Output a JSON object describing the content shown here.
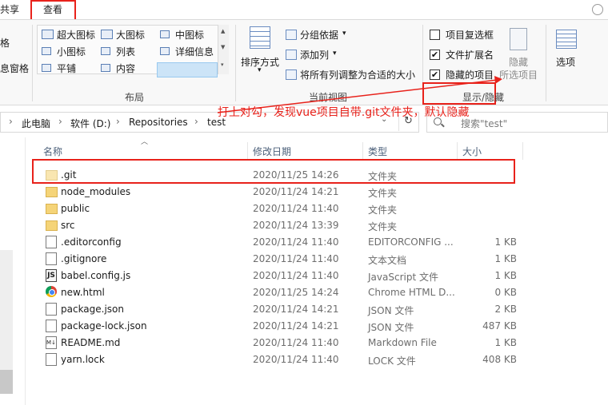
{
  "tabs": {
    "share": "共享",
    "view": "查看"
  },
  "ribbon": {
    "left_cut": {
      "top": "格",
      "bottom": "息窗格"
    },
    "layout": {
      "items": [
        "超大图标",
        "大图标",
        "中图标",
        "小图标",
        "列表",
        "详细信息",
        "平铺",
        "内容"
      ],
      "group": "布局"
    },
    "current_view": {
      "sort_label": "排序方式",
      "group_by": "分组依据",
      "add_columns": "添加列",
      "fit_columns": "将所有列调整为合适的大小",
      "group": "当前视图"
    },
    "show_hide": {
      "item_checkbox": "项目复选框",
      "extensions": "文件扩展名",
      "hidden_items": "隐藏的项目",
      "hide_label": "隐藏",
      "selected_items": "所选项目",
      "options": "选项",
      "group": "显示/隐藏",
      "checked_mark": "✔"
    }
  },
  "address": {
    "crumbs": [
      "此电脑",
      "软件 (D:)",
      "Repositories",
      "test"
    ],
    "sep": "›",
    "refresh": "↻",
    "dropdown": "⌄"
  },
  "search": {
    "placeholder": "搜索\"test\""
  },
  "annotation": "打上对勾，发现vue项目自带.git文件夹，默认隐藏",
  "columns": {
    "name": "名称",
    "date": "修改日期",
    "type": "类型",
    "size": "大小"
  },
  "files": [
    {
      "name": ".git",
      "date": "2020/11/25 14:26",
      "type": "文件夹",
      "size": "",
      "icon": "folder-icon"
    },
    {
      "name": "node_modules",
      "date": "2020/11/24 14:21",
      "type": "文件夹",
      "size": "",
      "icon": "folder-icon"
    },
    {
      "name": "public",
      "date": "2020/11/24 11:40",
      "type": "文件夹",
      "size": "",
      "icon": "folder-icon"
    },
    {
      "name": "src",
      "date": "2020/11/24 13:39",
      "type": "文件夹",
      "size": "",
      "icon": "folder-icon"
    },
    {
      "name": ".editorconfig",
      "date": "2020/11/24 11:40",
      "type": "EDITORCONFIG ...",
      "size": "1 KB",
      "icon": "file-icon"
    },
    {
      "name": ".gitignore",
      "date": "2020/11/24 11:40",
      "type": "文本文档",
      "size": "1 KB",
      "icon": "file-icon"
    },
    {
      "name": "babel.config.js",
      "date": "2020/11/24 11:40",
      "type": "JavaScript 文件",
      "size": "1 KB",
      "icon": "js-file-icon"
    },
    {
      "name": "new.html",
      "date": "2020/11/25 14:24",
      "type": "Chrome HTML D...",
      "size": "0 KB",
      "icon": "chrome-icon"
    },
    {
      "name": "package.json",
      "date": "2020/11/24 14:21",
      "type": "JSON 文件",
      "size": "2 KB",
      "icon": "file-icon"
    },
    {
      "name": "package-lock.json",
      "date": "2020/11/24 14:21",
      "type": "JSON 文件",
      "size": "487 KB",
      "icon": "file-icon"
    },
    {
      "name": "README.md",
      "date": "2020/11/24 11:40",
      "type": "Markdown File",
      "size": "1 KB",
      "icon": "markdown-icon"
    },
    {
      "name": "yarn.lock",
      "date": "2020/11/24 11:40",
      "type": "LOCK 文件",
      "size": "408 KB",
      "icon": "file-icon"
    }
  ],
  "colors": {
    "annotation_red": "#e8221b",
    "folder": "#f5d478",
    "column_header": "#4c607a"
  }
}
